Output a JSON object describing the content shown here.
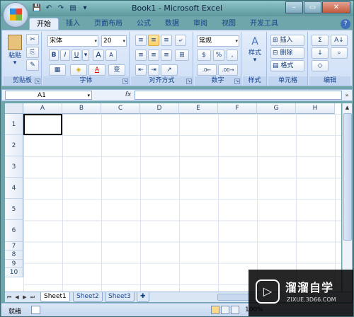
{
  "window": {
    "title": "Book1 - Microsoft Excel",
    "minimize": "–",
    "restore": "▭",
    "close": "✕"
  },
  "qat": {
    "save": "💾",
    "undo": "↶",
    "redo": "↷",
    "print_preview": "▤",
    "customize": "▾"
  },
  "tabs": [
    "开始",
    "插入",
    "页面布局",
    "公式",
    "数据",
    "审阅",
    "视图",
    "开发工具"
  ],
  "active_tab": "开始",
  "help": "?",
  "ribbon": {
    "clipboard": {
      "label": "剪贴板",
      "paste": "粘贴",
      "paste_arrow": "▾",
      "cut": "✂",
      "copy": "⎘",
      "format_painter": "✎"
    },
    "font": {
      "label": "字体",
      "font_name": "宋体",
      "font_size": "20",
      "bold": "B",
      "italic": "I",
      "underline": "U",
      "underline_arrow": "▾",
      "grow": "A",
      "shrink": "A",
      "border": "▦",
      "fill": "◈",
      "font_color": "A",
      "phonetic": "变"
    },
    "alignment": {
      "label": "对齐方式"
    },
    "number": {
      "label": "数字",
      "format": "常规",
      "currency": "$",
      "percent": "%",
      "comma": ",",
      "inc_decimal": ".0←",
      "dec_decimal": ".00→"
    },
    "styles": {
      "label": "样式",
      "styles_btn": "样式"
    },
    "cells": {
      "label": "单元格",
      "insert": "插入",
      "delete": "删除",
      "format": "格式"
    },
    "editing": {
      "label": "编辑",
      "sum": "Σ",
      "sort": "A↓",
      "find": "⌕",
      "fill": "↓",
      "clear": "◇"
    }
  },
  "formula_bar": {
    "name_box": "A1",
    "fx": "fx",
    "formula": ""
  },
  "sheet": {
    "columns": [
      "A",
      "B",
      "C",
      "D",
      "E",
      "F",
      "G",
      "H"
    ],
    "rows": [
      "1",
      "2",
      "3",
      "4",
      "5",
      "6",
      "7",
      "8",
      "9",
      "10"
    ]
  },
  "sheet_tabs": [
    "Sheet1",
    "Sheet2",
    "Sheet3"
  ],
  "active_sheet": "Sheet1",
  "status": {
    "ready": "就绪",
    "zoom": "100%"
  },
  "watermark": {
    "brand": "溜溜自学",
    "url": "ZIXUE.3D66.COM"
  },
  "colors": {
    "title_bar": "#6fa6ab",
    "ribbon": "#dbe7f8",
    "accent": "#15428b",
    "grid_line": "#dae3ef"
  }
}
